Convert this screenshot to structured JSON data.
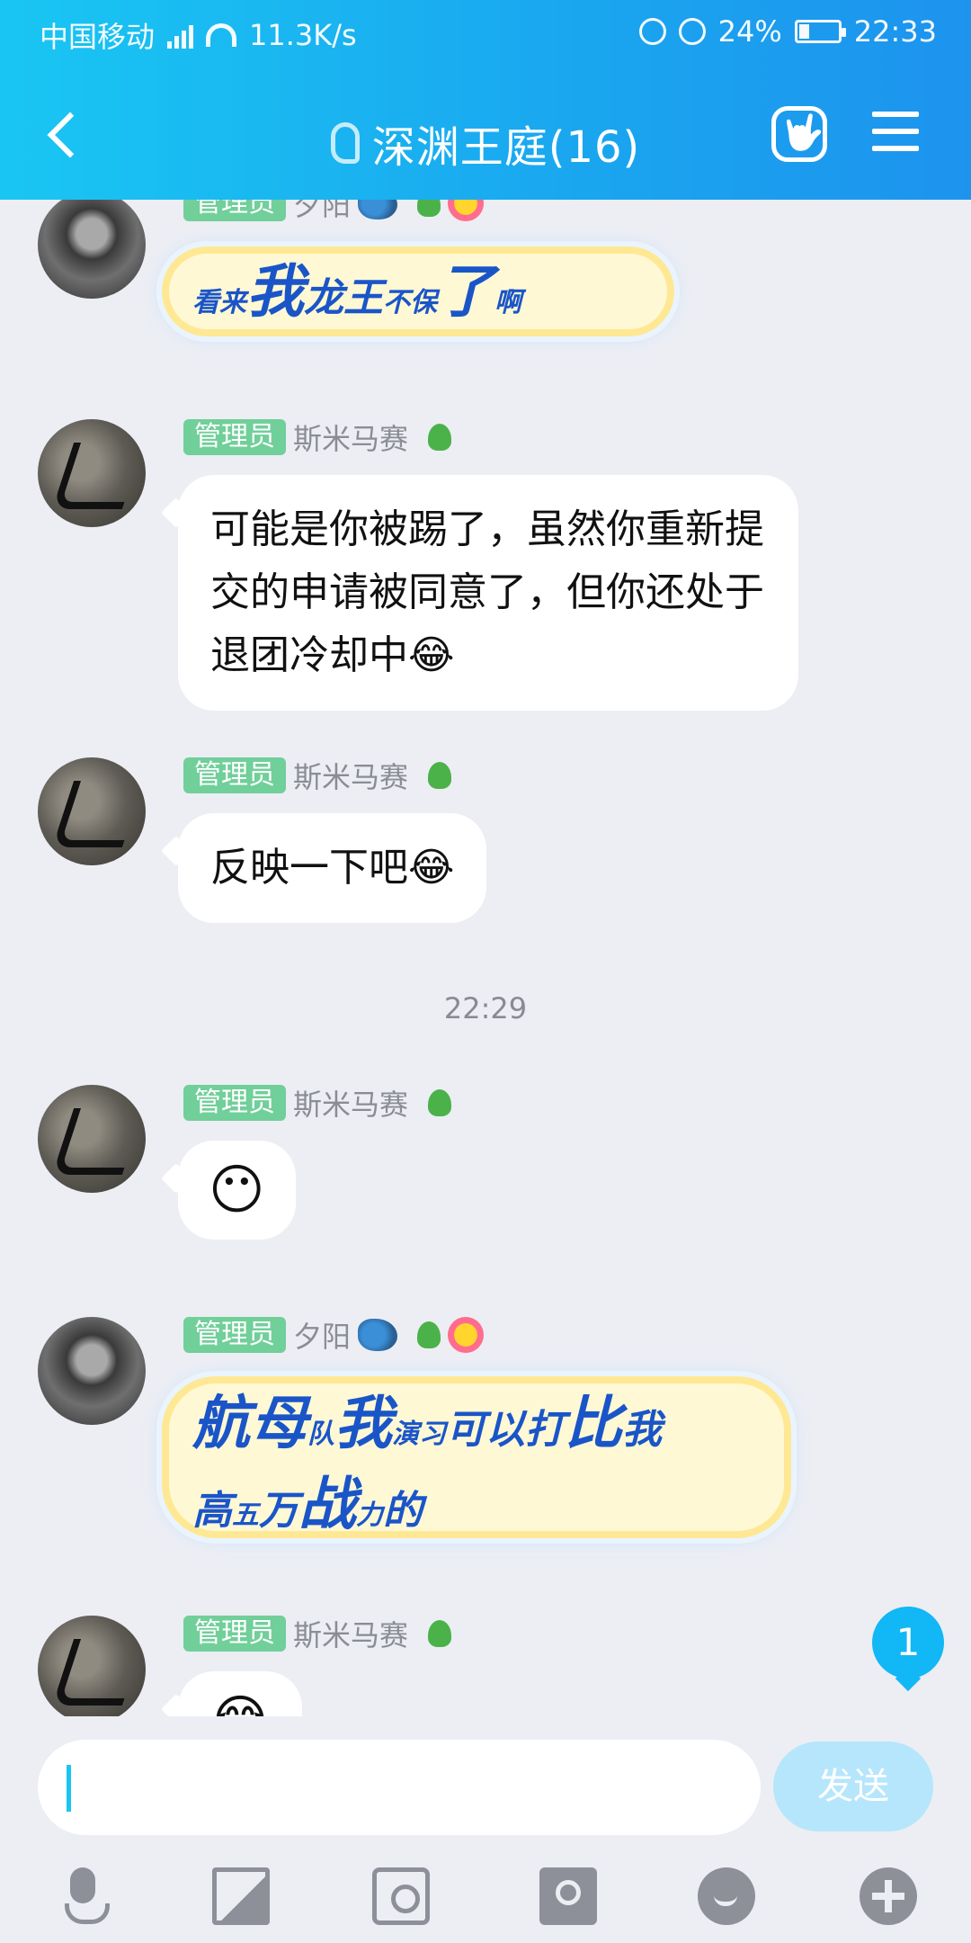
{
  "status_bar": {
    "carrier": "中国移动",
    "network_speed": "11.3K/s",
    "battery": "24%",
    "time": "22:33"
  },
  "header": {
    "title": "深渊王庭(16)"
  },
  "messages": [
    {
      "role": "管理员",
      "name": "夕阳",
      "fancy_lines": [
        [
          [
            "sm",
            "看来"
          ],
          [
            "big",
            "我"
          ],
          [
            "mid",
            "龙王"
          ],
          [
            "sm",
            "不保"
          ],
          [
            "big",
            "了"
          ],
          [
            "sm",
            "啊"
          ]
        ]
      ]
    },
    {
      "role": "管理员",
      "name": "斯米马赛",
      "text": "可能是你被踢了，虽然你重新提交的申请被同意了，但你还处于退团冷却中😂"
    },
    {
      "role": "管理员",
      "name": "斯米马赛",
      "text": "反映一下吧😂"
    },
    {
      "role": "管理员",
      "name": "斯米马赛",
      "text": "😶"
    },
    {
      "role": "管理员",
      "name": "夕阳",
      "fancy_lines": [
        [
          [
            "big",
            "航母"
          ],
          [
            "sm",
            "队"
          ],
          [
            "big",
            "我"
          ],
          [
            "sm",
            "演习"
          ],
          [
            "mid",
            "可以打"
          ],
          [
            "big",
            "比"
          ],
          [
            "mid",
            "我"
          ]
        ],
        [
          [
            "mid",
            "高"
          ],
          [
            "sm",
            "五"
          ],
          [
            "mid",
            "万"
          ],
          [
            "big",
            "战"
          ],
          [
            "sm",
            "力"
          ],
          [
            "mid",
            "的"
          ]
        ]
      ]
    },
    {
      "role": "管理员",
      "name": "斯米马赛",
      "text": "😂"
    }
  ],
  "time_divider": "22:29",
  "unread_count": "1",
  "input": {
    "placeholder": "",
    "send_label": "发送"
  },
  "colors": {
    "header_start": "#19c6f3",
    "header_end": "#1d93ee",
    "admin_badge": "#71cf9a",
    "send_button": "#b6e6fb",
    "fancy_text": "#1a55c8"
  }
}
